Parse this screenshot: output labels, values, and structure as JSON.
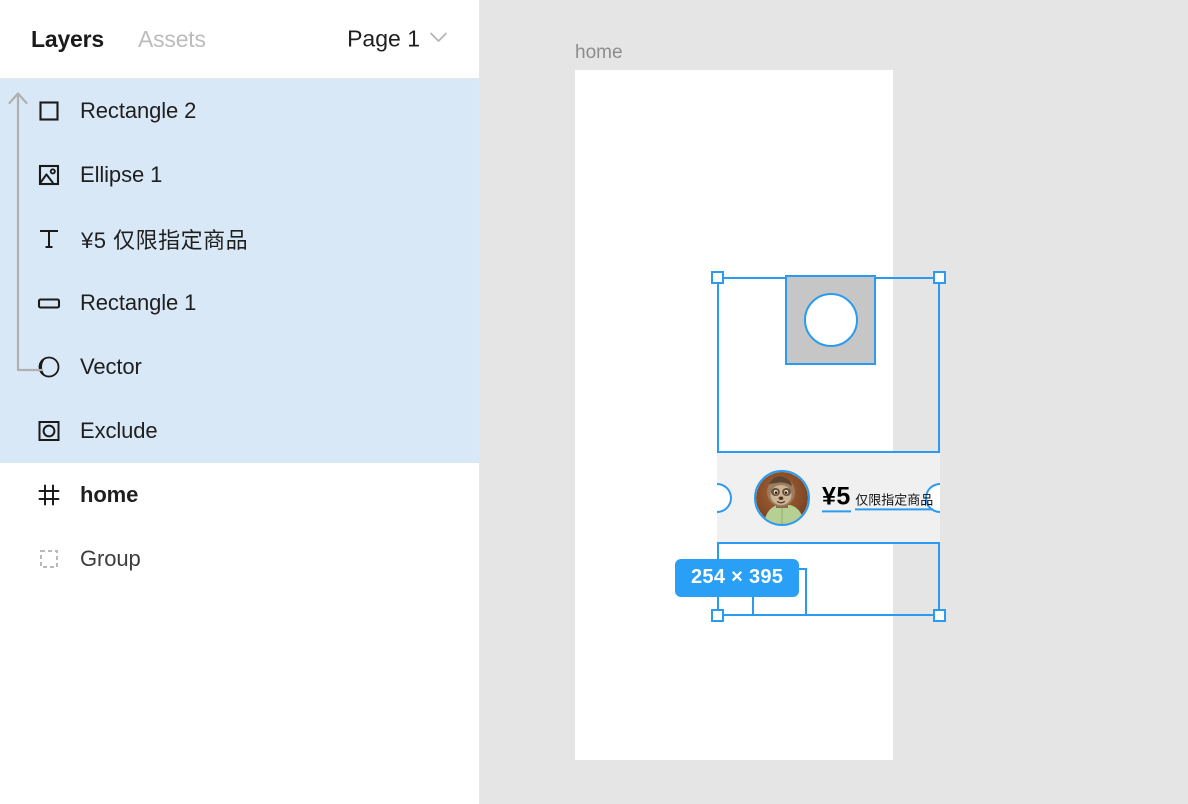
{
  "panel": {
    "tabs": [
      {
        "label": "Layers",
        "active": true
      },
      {
        "label": "Assets",
        "active": false
      }
    ],
    "page_selector": {
      "label": "Page 1",
      "icon": "chevron-down-icon"
    },
    "layers": [
      {
        "name": "Rectangle 2",
        "icon": "rectangle-icon",
        "selected": true,
        "bold": false,
        "cjk": false
      },
      {
        "name": "Ellipse 1",
        "icon": "image-icon",
        "selected": true,
        "bold": false,
        "cjk": false
      },
      {
        "name": "¥5 仅限指定商品",
        "icon": "text-icon",
        "selected": true,
        "bold": false,
        "cjk": true
      },
      {
        "name": "Rectangle 1",
        "icon": "rounded-rectangle-icon",
        "selected": true,
        "bold": false,
        "cjk": false
      },
      {
        "name": "Vector",
        "icon": "boolean-union-icon",
        "selected": true,
        "bold": false,
        "cjk": false
      },
      {
        "name": "Exclude",
        "icon": "boolean-exclude-icon",
        "selected": true,
        "bold": false,
        "cjk": false
      },
      {
        "name": "home",
        "icon": "frame-icon",
        "selected": false,
        "bold": true,
        "cjk": false
      },
      {
        "name": "Group",
        "icon": "group-icon",
        "selected": false,
        "bold": false,
        "cjk": false
      }
    ],
    "drag_indicator": {
      "icon": "drag-up-arrow-icon"
    }
  },
  "canvas": {
    "frame_label": "home",
    "dimension_badge": "254 × 395",
    "coupon": {
      "price": "¥5",
      "subtitle": "仅限指定商品",
      "avatar": "sloth-avatar"
    }
  },
  "colors": {
    "selection_blue": "#2a9bf0",
    "badge_blue": "#29a0f5",
    "row_selected": "#d9e8f6",
    "canvas_bg": "#e5e5e5",
    "placeholder_gray": "#c6c6c6",
    "coupon_bg": "#f0f0f0"
  }
}
